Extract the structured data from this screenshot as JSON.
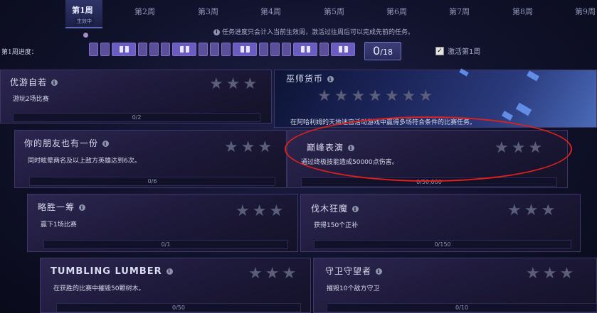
{
  "weeks": [
    {
      "label": "第1周",
      "active": true,
      "status": "生效中"
    },
    {
      "label": "第2周"
    },
    {
      "label": "第3周"
    },
    {
      "label": "第4周"
    },
    {
      "label": "第5周"
    },
    {
      "label": "第6周"
    },
    {
      "label": "第7周"
    },
    {
      "label": "第8周"
    },
    {
      "label": "第9周"
    }
  ],
  "notice": "任务进度只会计入当前生效周，激活过往周后可以完成先前的任务。",
  "progress": {
    "label": "第1周进度：",
    "counter_value": "0",
    "counter_total": "/18"
  },
  "activate": {
    "label": "激活第1周",
    "checked": true
  },
  "cards": [
    {
      "title": "优游自若",
      "desc": "游玩2场比赛",
      "progress": "0/2",
      "stars": 3
    },
    {
      "title": "巫师货币",
      "desc": "在阿哈利姆的天地迷宫活动游戏中赢得多场符合条件的比赛任务。",
      "progress": "",
      "stars": 7,
      "featured": true
    },
    {
      "title": "你的朋友也有一份",
      "desc": "同时眩晕两名及以上敌方英雄达到6次。",
      "progress": "0/6",
      "stars": 3
    },
    {
      "title": "巅峰表演",
      "desc": "通过终极技能造成50000点伤害。",
      "progress": "0/50,000",
      "stars": 3
    },
    {
      "title": "略胜一筹",
      "desc": "赢下1场比赛",
      "progress": "0/1",
      "stars": 3
    },
    {
      "title": "伐木狂魔",
      "desc": "获得150个正补",
      "progress": "0/150",
      "stars": 3
    },
    {
      "title": "TUMBLING LUMBER",
      "desc": "在获胜的比赛中摧毁50颗树木。",
      "progress": "0/50",
      "stars": 3
    },
    {
      "title": "守卫守望者",
      "desc": "摧毁10个敌方守卫",
      "progress": "0/10",
      "stars": 3
    }
  ],
  "colors": {
    "accent": "#6a5cc0",
    "highlight": "#e0201a",
    "star": "#5b5e78"
  }
}
